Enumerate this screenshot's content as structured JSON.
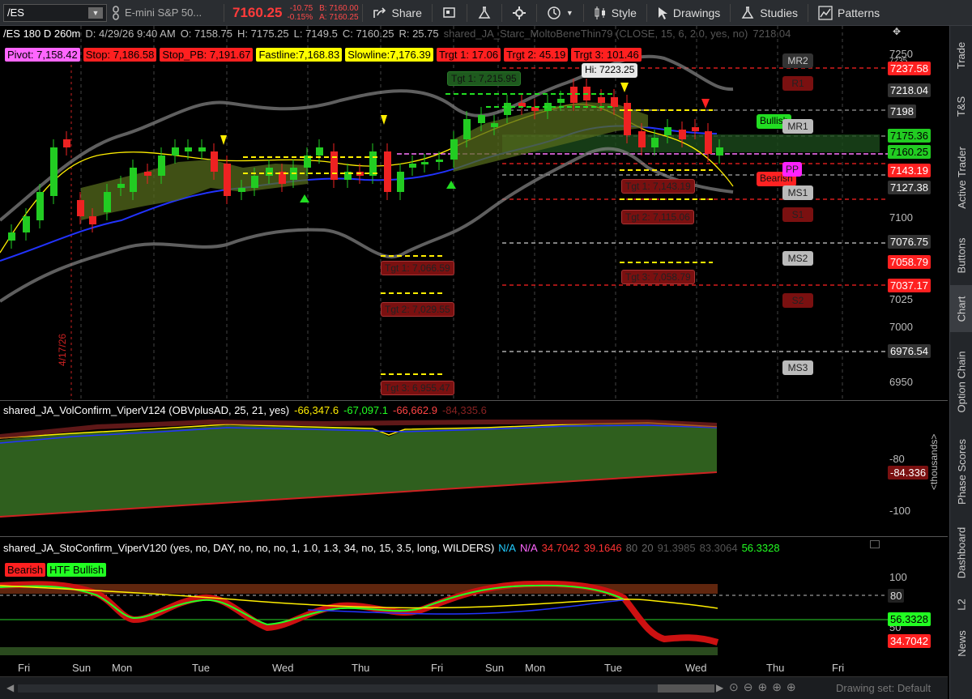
{
  "toolbar": {
    "symbol": "/ES",
    "quote_name": "E-mini S&P 50...",
    "last": "7160.25",
    "change": "-10.75",
    "change_pct": "-0.15%",
    "bid": "B: 7160.00",
    "ask": "A: 7160.25",
    "share": "Share",
    "style": "Style",
    "drawings": "Drawings",
    "studies": "Studies",
    "patterns": "Patterns"
  },
  "chart": {
    "header": [
      "/ES 180 D 260m",
      "D: 4/29/26 9:40 AM",
      "O: 7158.75",
      "H: 7175.25",
      "L: 7149.5",
      "C: 7160.25",
      "R: 25.75"
    ],
    "study_name": "shared_JA_Starc_MoltoBeneThin79 (CLOSE, 15, 6, 2.0, yes, no)",
    "study_value": "7218.04",
    "pivots": [
      {
        "text": "Pivot: 7,158.42",
        "bg": "#ff66ff",
        "fg": "#000"
      },
      {
        "text": "Stop: 7,186.58",
        "bg": "#ff2020",
        "fg": "#000"
      },
      {
        "text": "Stop_PB: 7,191.67",
        "bg": "#ff2020",
        "fg": "#000"
      },
      {
        "text": "Fastline:7,168.83",
        "bg": "#ffff00",
        "fg": "#000"
      },
      {
        "text": "Slowline:7,176.39",
        "bg": "#ffff00",
        "fg": "#000"
      },
      {
        "text": "Trgt 1: 17.06",
        "bg": "#ff2020",
        "fg": "#000"
      },
      {
        "text": "Trgt 2: 45.19",
        "bg": "#ff2020",
        "fg": "#000"
      },
      {
        "text": "Trgt 3: 101.46",
        "bg": "#ff2020",
        "fg": "#000"
      }
    ],
    "date_marker": "4/17/26",
    "hi_label": "Hi: 7223.25",
    "bullish": "Bullish",
    "bearish": "Bearish",
    "targets": [
      "Tgt 1: 7,215.95",
      "Tgt 1: 7,066.59",
      "Tgt 2: 7,029.55",
      "Tgt 3: 6,955.47",
      "Tgt 1: 7,143.19",
      "Tgt 2: 7,115.06",
      "Tgt 3: 7,058.79"
    ],
    "levels": [
      "MR2",
      "R1",
      "MR1",
      "PP",
      "MS1",
      "S1",
      "MS2",
      "S2",
      "MS3"
    ],
    "axis_ticks": [
      "7250",
      "7235",
      "7100",
      "7025",
      "7000",
      "6950"
    ],
    "price_tags": [
      {
        "text": "7237.58",
        "bg": "#ff2020",
        "fg": "#fff"
      },
      {
        "text": "7218.04",
        "bg": "#333",
        "fg": "#fff"
      },
      {
        "text": "7198",
        "bg": "#333",
        "fg": "#fff"
      },
      {
        "text": "7175.36",
        "bg": "#22cc22",
        "fg": "#000"
      },
      {
        "text": "7160.25",
        "bg": "#22cc22",
        "fg": "#000"
      },
      {
        "text": "7143.19",
        "bg": "#ff2020",
        "fg": "#fff"
      },
      {
        "text": "7127.38",
        "bg": "#333",
        "fg": "#fff"
      },
      {
        "text": "7076.75",
        "bg": "#333",
        "fg": "#fff"
      },
      {
        "text": "7058.79",
        "bg": "#ff2020",
        "fg": "#fff"
      },
      {
        "text": "7037.17",
        "bg": "#ff2020",
        "fg": "#fff"
      },
      {
        "text": "6976.54",
        "bg": "#333",
        "fg": "#fff"
      }
    ]
  },
  "vol": {
    "name": "shared_JA_VolConfirm_ViperV124 (OBVplusAD, 25, 21, yes)",
    "v1": "-66,347.6",
    "v2": "-67,097.1",
    "v3": "-66,662.9",
    "v4": "-84,335.6",
    "tick1": "-80",
    "tick2": "-100",
    "tag": "-84.336",
    "unit": "<thousands>"
  },
  "sto": {
    "name": "shared_JA_StoConfirm_ViperV120 (yes, no, DAY, no, no, no, 1, 1.0, 1.3, 34, no, 15, 3.5, long, WILDERS)",
    "values": [
      "N/A",
      "N/A",
      "34.7042",
      "39.1646",
      "80",
      "20",
      "91.3985",
      "83.3064",
      "56.3328"
    ],
    "bearish": "Bearish",
    "htf": "HTF Bullish",
    "tick100": "100",
    "tick80": "80",
    "tick50": "50",
    "tag1": "56.3328",
    "tag2": "34.7042"
  },
  "xaxis": [
    "Fri",
    "Sun",
    "Mon",
    "Tue",
    "Wed",
    "Thu",
    "Fri",
    "Sun",
    "Mon",
    "Tue",
    "Wed",
    "Thu",
    "Fri"
  ],
  "sidebar": [
    "Trade",
    "T&S",
    "Active Trader",
    "Buttons",
    "Chart",
    "Option Chain",
    "Phase Scores",
    "Dashboard",
    "L2",
    "News"
  ],
  "bottom": {
    "drawing_set": "Drawing set: Default"
  }
}
